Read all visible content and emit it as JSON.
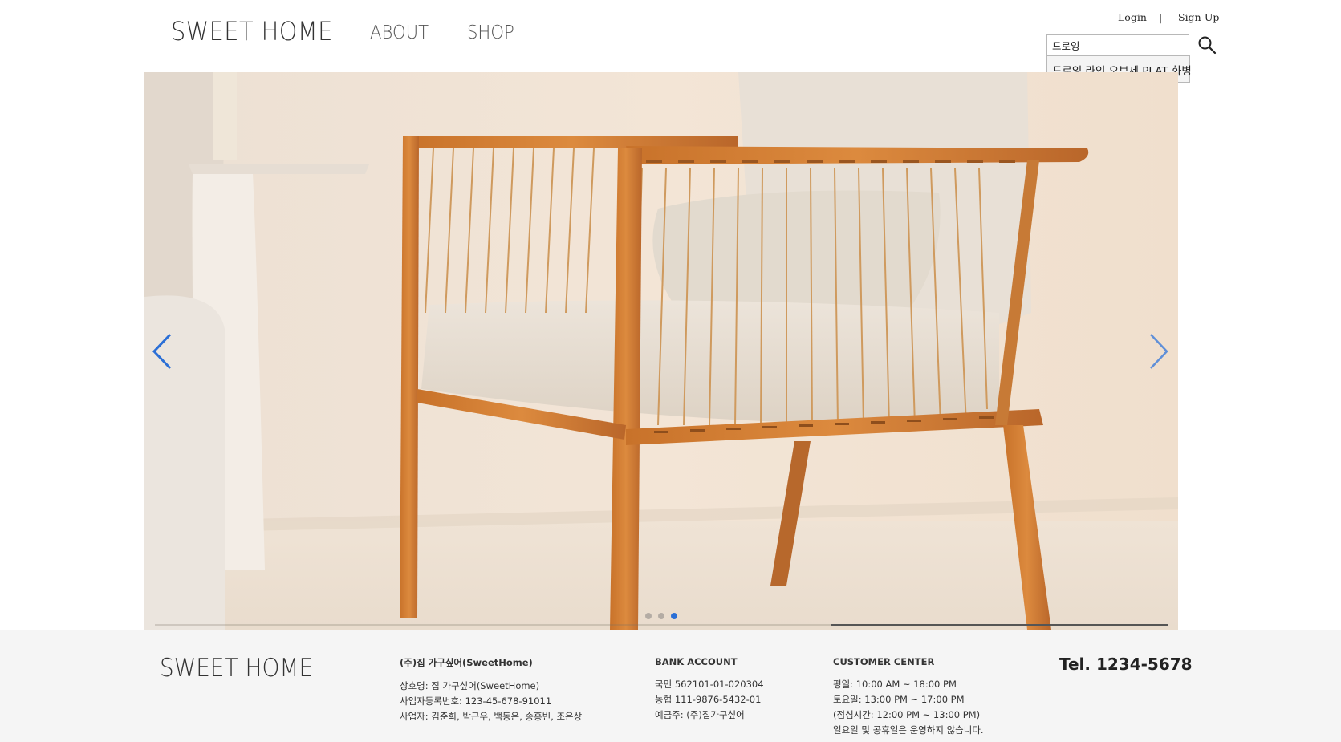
{
  "header": {
    "logo": "SWEET HOME",
    "nav": {
      "about": "ABOUT",
      "shop": "SHOP"
    },
    "auth": {
      "login": "Login",
      "separator": "|",
      "signup": "Sign-Up"
    },
    "search": {
      "value": "드로잉",
      "suggestion": "드로잉 라인 오브제 PLAT 화병",
      "icon": "search-icon"
    }
  },
  "slider": {
    "prev_icon": "chevron-left-icon",
    "next_icon": "chevron-right-icon",
    "slide_count": 3,
    "active_slide": 3,
    "progress_fraction": 0.333,
    "accent_color": "#2b6fd6"
  },
  "footer": {
    "logo": "SWEET HOME",
    "company": {
      "heading": "(주)집 가구싶어(SweetHome)",
      "lines": [
        "상호명: 집 가구싶어(SweetHome)",
        "사업자등록번호: 123-45-678-91011",
        "사업자: 김준희, 박근우, 백동은, 송홍빈, 조은상"
      ]
    },
    "bank": {
      "heading": "BANK ACCOUNT",
      "lines": [
        "국민 562101-01-020304",
        "농협 111-9876-5432-01",
        "예금주: (주)집가구싶어"
      ]
    },
    "customer_center": {
      "heading": "CUSTOMER CENTER",
      "lines": [
        "평일: 10:00 AM ~ 18:00 PM",
        "토요일: 13:00 PM ~ 17:00 PM",
        "(점심시간: 12:00 PM ~ 13:00 PM)",
        "일요일 및 공휴일은 운영하지 않습니다."
      ]
    },
    "tel": "Tel. 1234-5678"
  }
}
